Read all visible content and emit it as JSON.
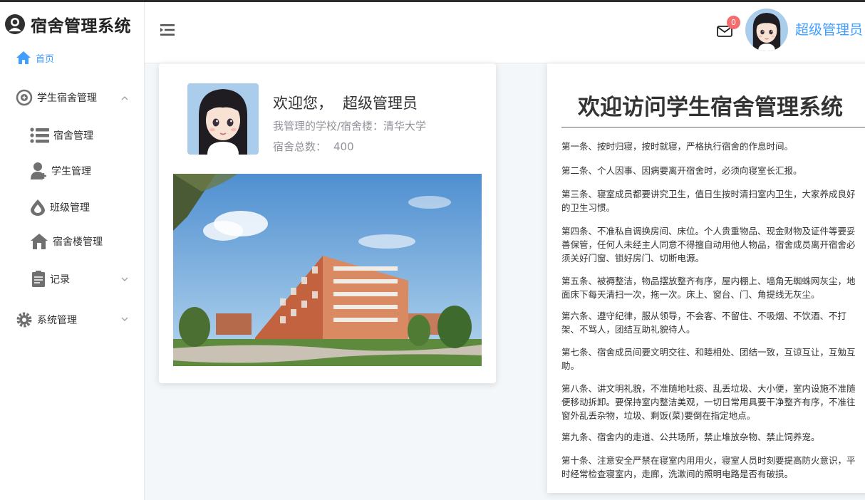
{
  "app": {
    "title": "宿舍管理系统"
  },
  "sidebar": {
    "items": [
      {
        "label": "首页"
      },
      {
        "label": "学生宿舍管理"
      },
      {
        "label": "宿舍管理"
      },
      {
        "label": "学生管理"
      },
      {
        "label": "班级管理"
      },
      {
        "label": "宿舍楼管理"
      },
      {
        "label": "记录"
      },
      {
        "label": "系统管理"
      }
    ]
  },
  "header": {
    "mail_badge": "0",
    "username": "超级管理员"
  },
  "welcome": {
    "greeting": "欢迎您，",
    "name": "超级管理员",
    "school_line": "我管理的学校/宿舍楼：清华大学",
    "dorm_total_label": "宿舍总数：",
    "dorm_total_value": "400"
  },
  "rules": {
    "title": "欢迎访问学生宿舍管理系统",
    "items": [
      "第一条、按时归寝，按时就寝，严格执行宿舍的作息时间。",
      "第二条、个人因事、因病要离开宿舍时，必须向寝室长汇报。",
      "第三条、寝室成员都要讲究卫生，值日生按时清扫室内卫生，大家养成良好的卫生习惯。",
      "第四条、不准私自调换房间、床位。个人贵重物品、现金财物及证件等要妥善保管，任何人未经主人同意不得擅自动用他人物品，宿舍成员离开宿舍必须关好门窗、锁好房门、切断电源。",
      "第五条、被褥整洁，物品摆放整齐有序，屋内棚上、墙角无蜘蛛网灰尘，地面床下每天清扫一次，拖一次。床上、窗台、门、角提线无灰尘。",
      "第六条、遵守纪律，服从领导，不会客、不留住、不吸烟、不饮酒、不打架、不骂人，团结互助礼貌待人。",
      "第七条、宿舍成员间要文明交往、和睦相处、团结一致，互谅互让，互勉互助。",
      "第八条、讲文明礼貌，不准随地吐痰、乱丢垃圾、大小便，室内设施不准随便移动拆卸。要保持室内整洁美观，一切日常用具要干净整齐有序，不准往窗外乱丢杂物，垃圾、剩饭(菜)要倒在指定地点。",
      "第九条、宿舍内的走道、公共场所，禁止堆放杂物、禁止饲养宠。",
      "第十条、注意安全严禁在寝室内用用火，寝室人员时刻要提高防火意识，平时经常检查寝室内，走廊，洗漱间的照明电路是否有破损。"
    ]
  },
  "colors": {
    "accent": "#409eff",
    "badge": "#f56c6c",
    "muted": "#909399"
  }
}
